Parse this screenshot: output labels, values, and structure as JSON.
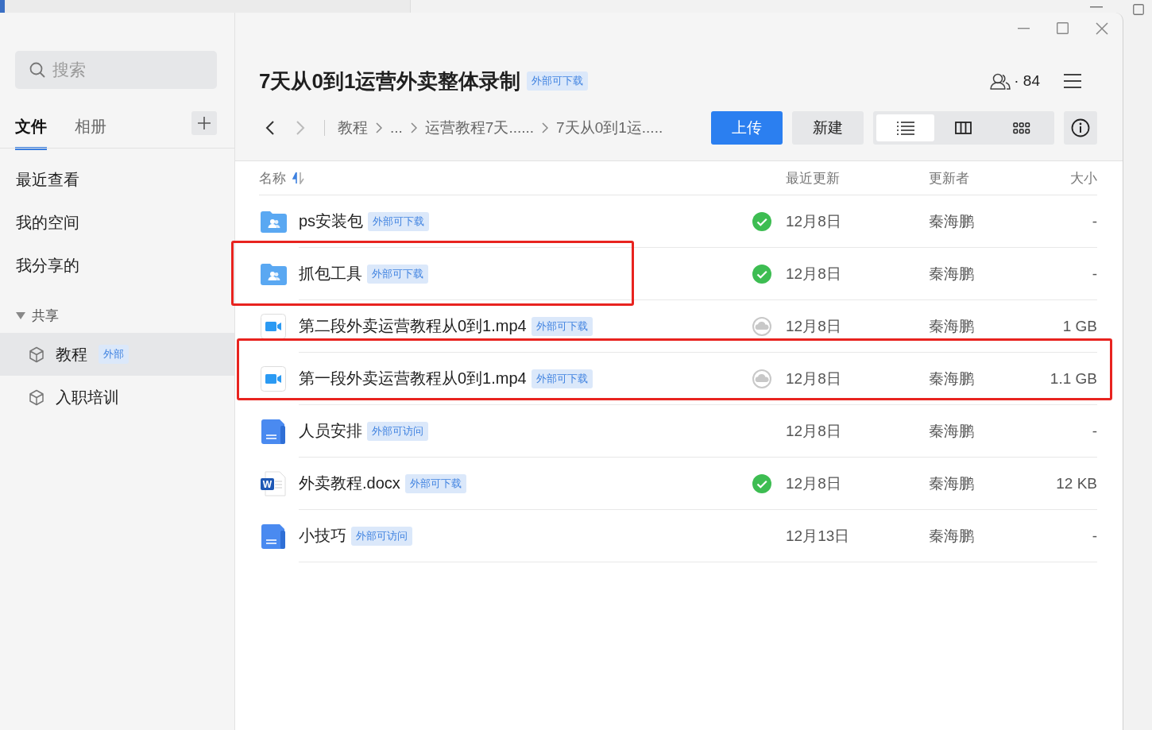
{
  "window": {
    "title": "7天从0到1运营外卖整体录制",
    "badge": "外部可下载",
    "members": "· 84"
  },
  "sidebar": {
    "search": {
      "placeholder": "搜索"
    },
    "tabs": [
      {
        "label": "文件",
        "selected": true
      },
      {
        "label": "相册",
        "selected": false
      }
    ],
    "nav": [
      {
        "label": "最近查看",
        "selected": false
      },
      {
        "label": "我的空间",
        "selected": false
      },
      {
        "label": "我分享的",
        "selected": false
      }
    ],
    "shared": {
      "label": "共享",
      "expanded": true,
      "items": [
        {
          "label": "教程",
          "badge": "外部",
          "selected": true
        },
        {
          "label": "入职培训",
          "selected": false
        }
      ]
    }
  },
  "toolbar": {
    "nav_buttons": [
      {
        "kind": "back",
        "disabled": false
      },
      {
        "kind": "forward",
        "disabled": true
      }
    ],
    "breadcrumb": [
      "教程",
      "...",
      "运营教程7天......",
      "7天从0到1运....."
    ],
    "buttons": [
      {
        "label": "上传",
        "kind": "primary"
      },
      {
        "label": "新建",
        "kind": "secondary"
      }
    ],
    "views": [
      {
        "kind": "list",
        "selected": true
      },
      {
        "kind": "columns",
        "selected": false
      },
      {
        "kind": "grid",
        "selected": false
      }
    ]
  },
  "table": {
    "columns": [
      "名称",
      "最近更新",
      "更新者",
      "大小"
    ],
    "rows": [
      {
        "kind": "shared-folder",
        "name": "ps安装包",
        "badge": "外部可下载",
        "synced": true,
        "cloud_only": false,
        "updated": "12月8日",
        "updater": "秦海鹏",
        "size": "-",
        "name_highlighted": false,
        "row_highlighted": false
      },
      {
        "kind": "shared-folder",
        "name": "抓包工具",
        "badge": "外部可下载",
        "synced": true,
        "cloud_only": false,
        "updated": "12月8日",
        "updater": "秦海鹏",
        "size": "-",
        "name_highlighted": true,
        "row_highlighted": false
      },
      {
        "kind": "video",
        "name": "第二段外卖运营教程从0到1.mp4",
        "badge": "外部可下载",
        "synced": false,
        "cloud_only": true,
        "updated": "12月8日",
        "updater": "秦海鹏",
        "size": "1 GB",
        "name_highlighted": false,
        "row_highlighted": false
      },
      {
        "kind": "video",
        "name": "第一段外卖运营教程从0到1.mp4",
        "badge": "外部可下载",
        "synced": false,
        "cloud_only": true,
        "updated": "12月8日",
        "updater": "秦海鹏",
        "size": "1.1 GB",
        "name_highlighted": false,
        "row_highlighted": true
      },
      {
        "kind": "doc",
        "name": "人员安排",
        "badge": "外部可访问",
        "synced": false,
        "cloud_only": false,
        "updated": "12月8日",
        "updater": "秦海鹏",
        "size": "-",
        "name_highlighted": false,
        "row_highlighted": false
      },
      {
        "kind": "word",
        "icon_letter": "W",
        "name": "外卖教程.docx",
        "badge": "外部可下载",
        "synced": true,
        "cloud_only": false,
        "updated": "12月8日",
        "updater": "秦海鹏",
        "size": "12 KB",
        "name_highlighted": false,
        "row_highlighted": false
      },
      {
        "kind": "doc",
        "name": "小技巧",
        "badge": "外部可访问",
        "synced": false,
        "cloud_only": false,
        "updated": "12月13日",
        "updater": "秦海鹏",
        "size": "-",
        "name_highlighted": false,
        "row_highlighted": false
      }
    ]
  }
}
